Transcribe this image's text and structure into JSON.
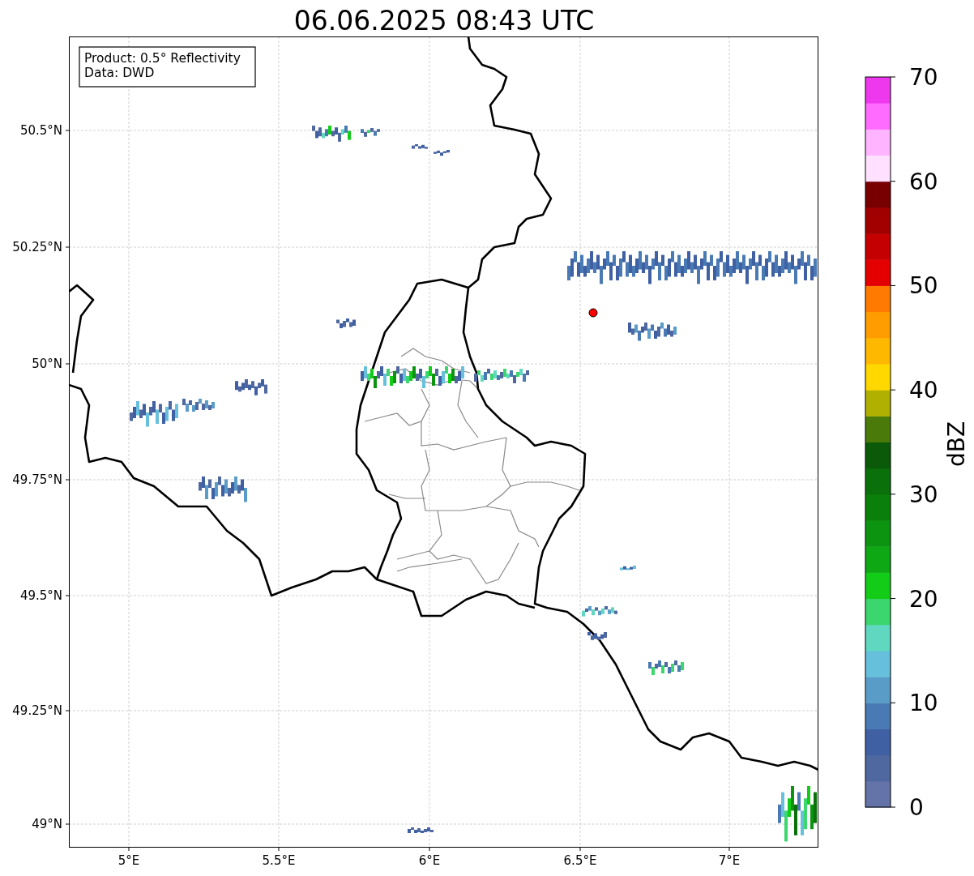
{
  "title": "06.06.2025 08:43 UTC",
  "info_box": {
    "lines": [
      "Product: 0.5° Reflectivity",
      "Data: DWD"
    ]
  },
  "map": {
    "lat_ticks": [
      "50.5°N",
      "50.25°N",
      "50°N",
      "49.75°N",
      "49.5°N",
      "49.25°N",
      "49°N"
    ],
    "lon_ticks": [
      "5°E",
      "5.5°E",
      "6°E",
      "6.5°E",
      "7°E"
    ]
  },
  "colorbar": {
    "label": "dBZ",
    "ticks": [
      "70",
      "60",
      "50",
      "40",
      "30",
      "20",
      "10",
      "0"
    ],
    "bins": [
      {
        "color": "#6474a8"
      },
      {
        "color": "#5068a0"
      },
      {
        "color": "#4060a4"
      },
      {
        "color": "#4a7ab4"
      },
      {
        "color": "#5a9cc8"
      },
      {
        "color": "#66c0dc"
      },
      {
        "color": "#60d8c0"
      },
      {
        "color": "#3cd66e"
      },
      {
        "color": "#12cc18"
      },
      {
        "color": "#0ea814"
      },
      {
        "color": "#0c9410"
      },
      {
        "color": "#0a800a"
      },
      {
        "color": "#0a700a"
      },
      {
        "color": "#0a5a0a"
      },
      {
        "color": "#4a7a0a"
      },
      {
        "color": "#b0b000"
      },
      {
        "color": "#ffd800"
      },
      {
        "color": "#ffb800"
      },
      {
        "color": "#ff9c00"
      },
      {
        "color": "#ff7a00"
      },
      {
        "color": "#e40000"
      },
      {
        "color": "#c40000"
      },
      {
        "color": "#a00000"
      },
      {
        "color": "#780000"
      },
      {
        "color": "#ffe0ff"
      },
      {
        "color": "#ffb4ff"
      },
      {
        "color": "#ff6aff"
      },
      {
        "color": "#ee38ee"
      }
    ]
  }
}
